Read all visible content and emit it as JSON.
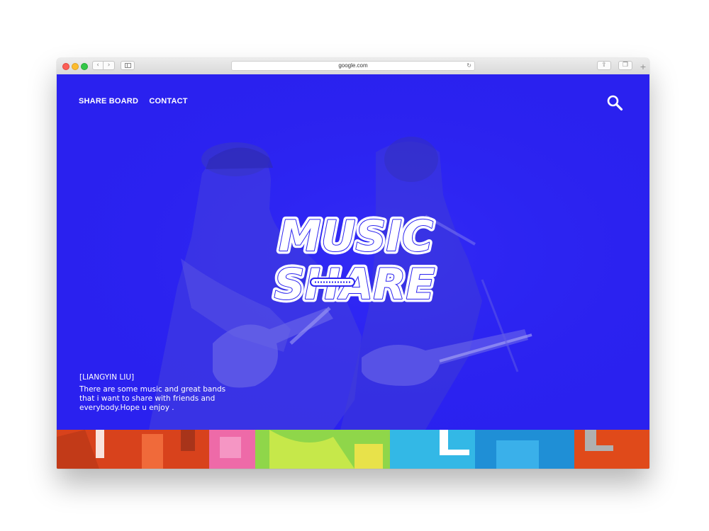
{
  "browser": {
    "url": "google.com",
    "back_glyph": "‹",
    "forward_glyph": "›",
    "reload_glyph": "↻",
    "share_glyph": "⇪",
    "tabs_glyph": "❐",
    "new_tab_glyph": "+"
  },
  "nav": {
    "items": [
      {
        "label": "SHARE BOARD"
      },
      {
        "label": "CONTACT"
      }
    ]
  },
  "logo": {
    "line1": "MUSIC",
    "line2": "SHARE"
  },
  "caption": {
    "name": "[LIANGYIN LIU]",
    "text": "There are some music and great bands that i want to share with friends and everybody.Hope u enjoy ."
  },
  "colors": {
    "hero_blue": "#2a22f0",
    "logo_stroke": "#2a22f0",
    "strip_red": "#e84a1f",
    "strip_green": "#8fd64a",
    "strip_cyan": "#33b8e6"
  },
  "icons": {
    "search": "search-icon",
    "close": "close-window-icon",
    "minimize": "minimize-window-icon",
    "maximize": "maximize-window-icon"
  }
}
